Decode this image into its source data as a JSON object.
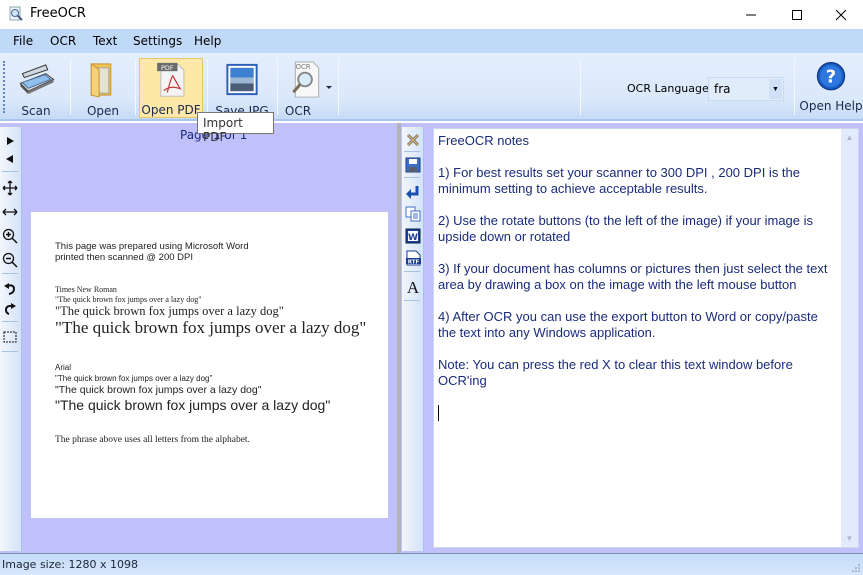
{
  "window": {
    "title": "FreeOCR",
    "minimize": "minimize",
    "maximize": "maximize",
    "close": "close"
  },
  "menu": {
    "items": [
      {
        "label": "File"
      },
      {
        "label": "OCR"
      },
      {
        "label": "Text"
      },
      {
        "label": "Settings"
      },
      {
        "label": "Help"
      }
    ]
  },
  "toolbar": {
    "scan_label": "Scan",
    "open_label": "Open",
    "open_pdf_label": "Open PDF",
    "save_jpg_label": "Save JPG",
    "ocr_label": "OCR",
    "ocr_language_label": "OCR Language:",
    "ocr_language_value": "fra",
    "open_help_label": "Open Help",
    "tooltip": "Import PDF"
  },
  "image_panel": {
    "page_label": "Page 1 of 1",
    "tools": [
      "next-page",
      "previous-page",
      "pan",
      "fit-width",
      "zoom-in",
      "zoom-out",
      "rotate-left",
      "rotate-right",
      "select-area"
    ],
    "document": {
      "intro_line1": "This page was prepared using Microsoft Word",
      "intro_line2": "printed then scanned @ 200 DPI",
      "times_heading": "Times New Roman",
      "times_small": "\"The quick brown fox jumps over a lazy dog\"",
      "times_medium": "\"The quick brown fox jumps over a lazy dog\"",
      "times_large": "\"The quick brown fox jumps over a lazy dog\"",
      "arial_heading": "Arial",
      "arial_small": "\"The quick brown fox jumps over a lazy dog\"",
      "arial_medium": "\"The quick brown fox  jumps over a lazy dog\"",
      "arial_large": "\"The quick brown fox jumps over a lazy dog\"",
      "footer": "The phrase above uses all letters from the alphabet."
    }
  },
  "text_panel": {
    "tools": [
      "clear-text",
      "save-text",
      "insert-break",
      "copy",
      "export-word",
      "export-rtf",
      "font"
    ],
    "content": "FreeOCR notes\n\n1) For best results set your scanner to 300 DPI , 200 DPI is the minimum setting to achieve acceptable results.\n\n2) Use the rotate buttons (to the left of the image) if your image is upside down or rotated\n\n3) If your document has columns or pictures then just select the text area by drawing a box on the image with the left mouse button\n\n4) After OCR you can use the export button to Word or copy/paste the text into any Windows application.\n\nNote: You can press the red X to clear this text window before OCR'ing"
  },
  "status": {
    "text": "Image size:  1280 x  1098"
  },
  "colors": {
    "menubar": "#c0d9f8",
    "workspace": "#c0c0fa",
    "text_color": "#1a2b7a",
    "highlight": "#fde8a8"
  }
}
